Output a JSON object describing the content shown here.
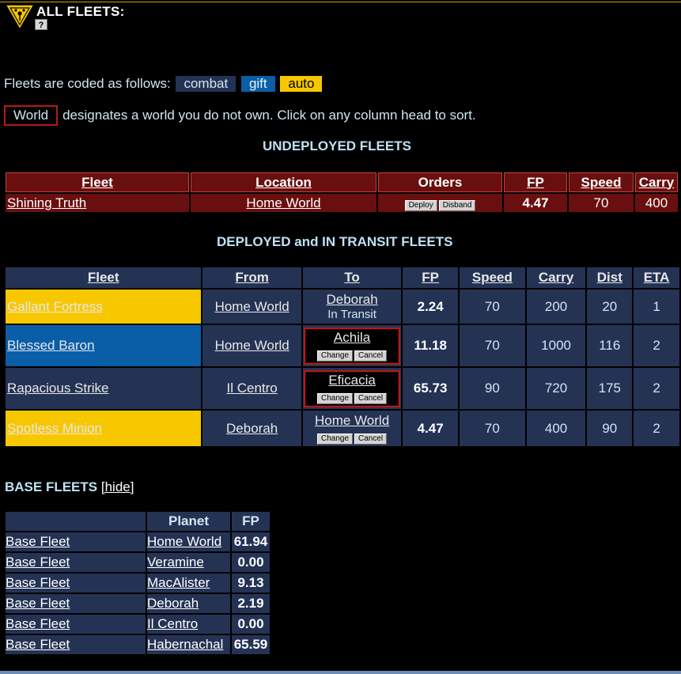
{
  "header": {
    "title": "ALL FLEETS:",
    "help_icon": "?"
  },
  "legend": {
    "intro": "Fleets are coded as follows:",
    "codes": [
      "combat",
      "gift",
      "auto"
    ]
  },
  "world_note": {
    "sample": "World",
    "text": "designates a world you do not own. Click on any column head to sort."
  },
  "undeployed": {
    "title": "UNDEPLOYED FLEETS",
    "columns": [
      "Fleet",
      "Location",
      "Orders",
      "FP",
      "Speed",
      "Carry"
    ],
    "rows": [
      {
        "fleet": "Shining Truth",
        "location": "Home World",
        "deploy": "Deploy",
        "disband": "Disband",
        "fp": "4.47",
        "speed": "70",
        "carry": "400"
      }
    ]
  },
  "deployed": {
    "title": "DEPLOYED and IN TRANSIT FLEETS",
    "columns": [
      "Fleet",
      "From",
      "To",
      "FP",
      "Speed",
      "Carry",
      "Dist",
      "ETA"
    ],
    "change_label": "Change",
    "cancel_label": "Cancel",
    "rows": [
      {
        "code": "auto",
        "fleet": "Gallant Fortress",
        "from": "Home World",
        "to": "Deborah",
        "to_note": "In Transit",
        "fp": "2.24",
        "speed": "70",
        "carry": "200",
        "dist": "20",
        "eta": "1"
      },
      {
        "code": "gift",
        "fleet": "Blessed Baron",
        "from": "Home World",
        "to": "Achila",
        "to_note": "",
        "fp": "11.18",
        "speed": "70",
        "carry": "1000",
        "dist": "116",
        "eta": "2"
      },
      {
        "code": "combat",
        "fleet": "Rapacious Strike",
        "from": "Il Centro",
        "to": "Eficacia",
        "to_note": "",
        "fp": "65.73",
        "speed": "90",
        "carry": "720",
        "dist": "175",
        "eta": "2"
      },
      {
        "code": "auto",
        "fleet": "Spotless Minion",
        "from": "Deborah",
        "to": "Home World",
        "to_note": "",
        "fp": "4.47",
        "speed": "70",
        "carry": "400",
        "dist": "90",
        "eta": "2"
      }
    ]
  },
  "base": {
    "title": "BASE FLEETS",
    "hide_label": "[hide]",
    "columns": [
      "",
      "Planet",
      "FP"
    ],
    "rows": [
      {
        "fleet": "Base Fleet",
        "planet": "Home World",
        "fp": "61.94"
      },
      {
        "fleet": "Base Fleet",
        "planet": "Veramine",
        "fp": "0.00"
      },
      {
        "fleet": "Base Fleet",
        "planet": "MacAlister",
        "fp": "9.13"
      },
      {
        "fleet": "Base Fleet",
        "planet": "Deborah",
        "fp": "2.19"
      },
      {
        "fleet": "Base Fleet",
        "planet": "Il Centro",
        "fp": "0.00"
      },
      {
        "fleet": "Base Fleet",
        "planet": "Habernachal",
        "fp": "65.59"
      }
    ]
  },
  "colors": {
    "auto": "#f7c700",
    "gift": "#0a5ea8",
    "combat": "#243354",
    "undeployed": "#6a0f0f",
    "border_red": "#b31b1b"
  },
  "icons": {
    "logo": "triangle-emblem-icon",
    "help": "help-icon"
  }
}
